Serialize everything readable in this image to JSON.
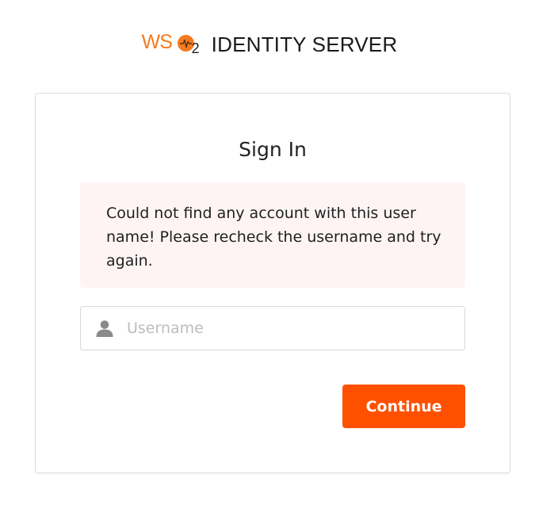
{
  "header": {
    "logo_text": "WSO2",
    "logo_ws": "WS",
    "logo_sub": "2",
    "brand_name": "IDENTITY SERVER"
  },
  "card": {
    "title": "Sign In",
    "error_message": "Could not find any account with this user name! Please recheck the username and try again.",
    "username_field": {
      "value": "",
      "placeholder": "Username",
      "icon": "user-icon"
    },
    "continue_label": "Continue"
  },
  "colors": {
    "brand_orange": "#f47b20",
    "button": "#ff5000",
    "alert_background": "#fff4f4"
  }
}
